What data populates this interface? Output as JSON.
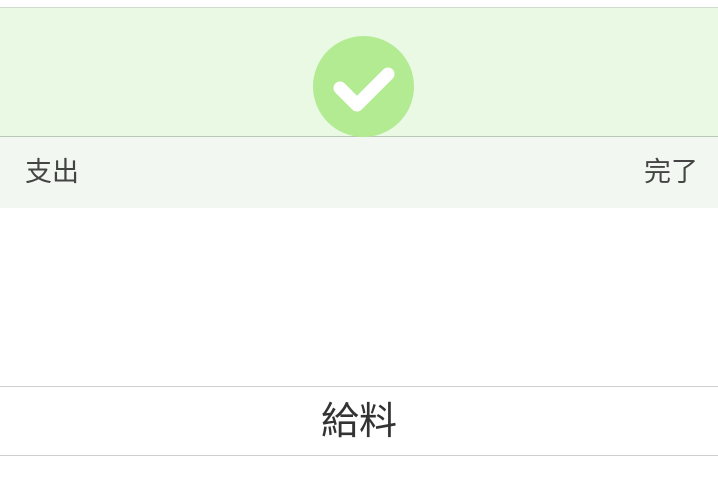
{
  "colors": {
    "banner_background": "#e9f9e3",
    "check_badge": "#b2eb92",
    "toolbar_background": "#f2f7f1",
    "text": "#444444"
  },
  "banner": {
    "icon": "checkmark-icon"
  },
  "toolbar": {
    "left_label": "支出",
    "done_label": "完了"
  },
  "picker": {
    "selected_option": "給料"
  }
}
